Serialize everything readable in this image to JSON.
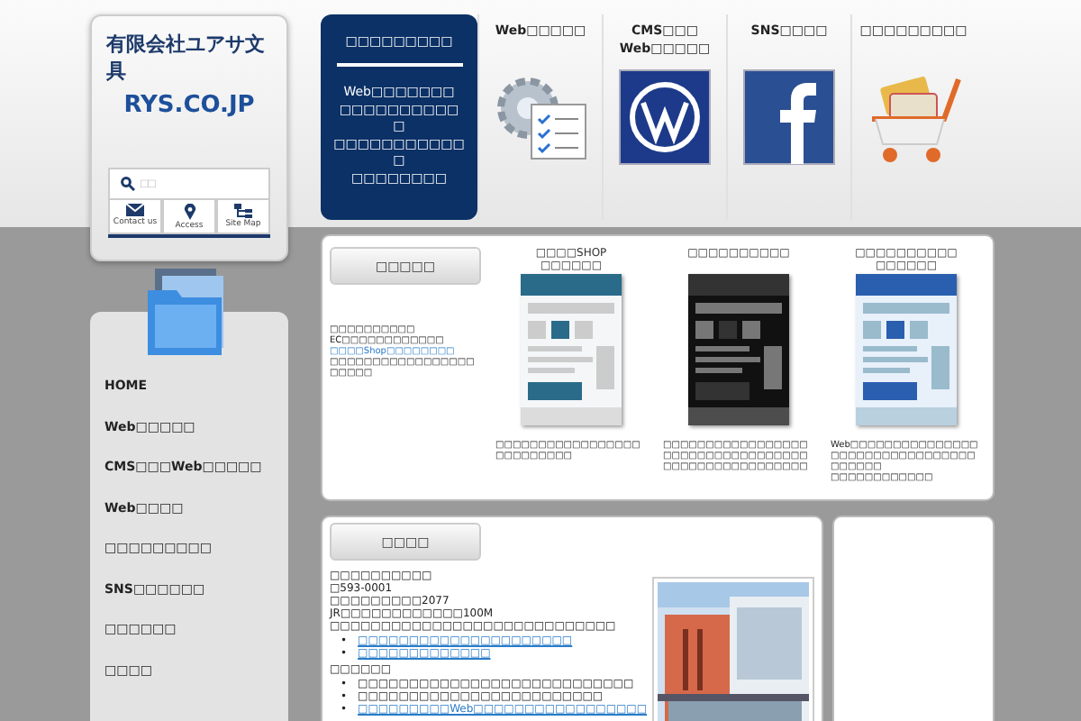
{
  "logo": {
    "company": "有限会社ユアサ文具",
    "domain": "RYS.CO.JP"
  },
  "search": {
    "placeholder": "□□"
  },
  "quick_links": [
    {
      "label": "Contact us",
      "kind": "mail"
    },
    {
      "label": "Access",
      "kind": "pin"
    },
    {
      "label": "Site Map",
      "kind": "sitemap"
    }
  ],
  "side_menu": [
    {
      "label": "HOME"
    },
    {
      "label": "Web□□□□□"
    },
    {
      "label": "CMS□□□Web□□□□□"
    },
    {
      "label": "Web□□□□"
    },
    {
      "label": "□□□□□□□□□"
    },
    {
      "label": "SNS□□□□□□"
    },
    {
      "label": "□□□□□□"
    },
    {
      "label": "□□□□"
    }
  ],
  "feature": {
    "title": "□□□□□□□□□",
    "lines": [
      "Web□□□□□□□",
      "□□□□□□□□□□",
      "□",
      "□□□□□□□□□□□",
      "□",
      "□□□□□□□□"
    ]
  },
  "nav": [
    {
      "lines": [
        "Web□□□□□"
      ],
      "kind": "gear"
    },
    {
      "lines": [
        "CMS□□□",
        "Web□□□□□"
      ],
      "kind": "wordpress"
    },
    {
      "lines": [
        "SNS□□□□"
      ],
      "kind": "facebook"
    },
    {
      "lines": [
        "□□□□□□□□□"
      ],
      "kind": "cart"
    }
  ],
  "services": {
    "heading": "□□□□□",
    "intro": [
      {
        "text": "□□□□□□□□□□",
        "link": false
      },
      {
        "text": "EC□□□□□□□□□□□□",
        "link": false
      },
      {
        "text": "□□□□Shop□□□□□□□□",
        "link": true
      },
      {
        "text": "□□□□□□□□□□□□□□□□□□□□□□",
        "link": false
      }
    ],
    "sites": [
      {
        "title": [
          "□□□□SHOP",
          "□□□□□□"
        ],
        "kind": "picture",
        "description": [
          "□□□□□□□□□□□□□□□□□",
          "□□□□□□□□□"
        ]
      },
      {
        "title": [
          "□□□□□□□□□□"
        ],
        "kind": "picture",
        "description": [
          "□□□□□□□□□□□□□□□□□",
          "□□□□□□□□□□□□□□□□□",
          "□□□□□□□□□□□□□□□□□"
        ]
      },
      {
        "title": [
          "□□□□□□□□□□",
          "□□□□□□"
        ],
        "kind": "picture",
        "description": [
          "Web□□□□□□□□□□□□□□□",
          "□□□□□□□□□□□□□□□□□",
          "□□□□□□",
          "□□□□□□□□□□□□"
        ]
      }
    ]
  },
  "company": {
    "heading": "□□□□",
    "lines": [
      "□□□□□□□□□□",
      "□593-0001",
      "□□□□□□□□□2077",
      "JR□□□□□□□□□□□□100M",
      "□□□□□□□□□□□□□□□□□□□□□□□□□□□□"
    ],
    "links": [
      {
        "bullet": "•",
        "text": "□□□□□□□□□□□□□□□□□□□□□"
      },
      {
        "bullet": "•",
        "text": "□□□□□□□□□□□□□"
      }
    ],
    "subheading": "□□□□□□",
    "items": [
      {
        "bullet": "•",
        "text": "□□□□□□□□□□□□□□□□□□□□□□□□□□□",
        "link": false
      },
      {
        "bullet": "•",
        "text": "□□□□□□□□□□□□□□□□□□□□□□□□",
        "link": false
      },
      {
        "bullet": "•",
        "text": "□□□□□□□□□Web□□□□□□□□□□□□□□□□□",
        "link": true
      }
    ]
  }
}
